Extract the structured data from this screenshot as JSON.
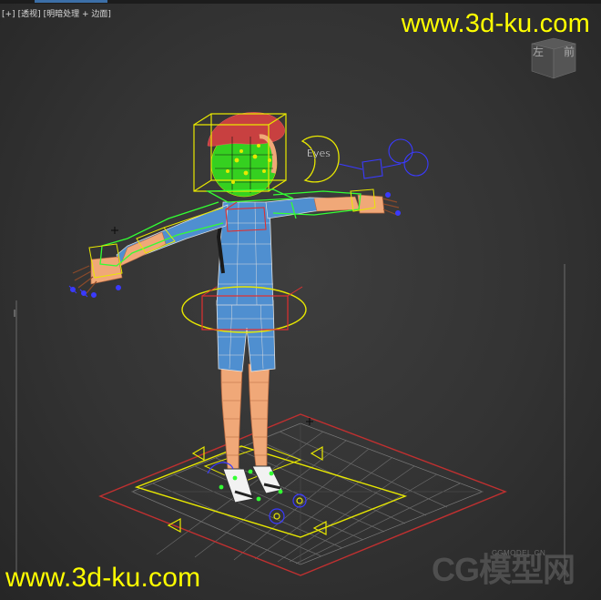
{
  "viewport": {
    "labels": [
      "[+]",
      "[透视]",
      "[明暗处理 + 边面]"
    ]
  },
  "watermark": {
    "top": "www.3d-ku.com",
    "bottom": "www.3d-ku.com",
    "cg_logo": "CG模型网",
    "cg_sub": "CGMODEL.CN"
  },
  "viewcube": {
    "left": "左",
    "front": "前"
  },
  "rig": {
    "eyes_label": "Eyes"
  },
  "colors": {
    "watermark": "#ffff00",
    "helper_yellow": "#e8e800",
    "helper_green": "#33ff33",
    "helper_red": "#e03030",
    "helper_blue": "#3a3aff",
    "body_blue": "#4f8fd0",
    "skin": "#f0a878",
    "hair": "#c84040"
  }
}
